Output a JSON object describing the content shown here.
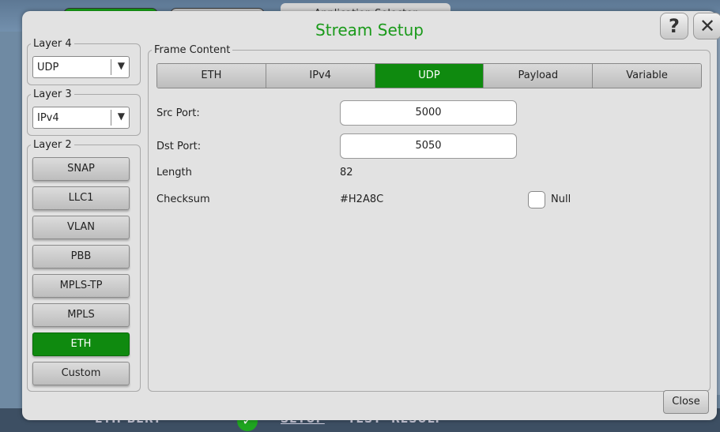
{
  "background": {
    "app_selector_label": "Application Selector",
    "bottom_bar": [
      "ETH-BERT",
      "SETUP",
      "TEST",
      "RESULT"
    ]
  },
  "dialog": {
    "title": "Stream Setup",
    "help_icon": "?",
    "close_icon": "✕",
    "close_button": "Close"
  },
  "layer4": {
    "legend": "Layer 4",
    "value": "UDP"
  },
  "layer3": {
    "legend": "Layer 3",
    "value": "IPv4"
  },
  "layer2": {
    "legend": "Layer 2",
    "buttons": [
      "SNAP",
      "LLC1",
      "VLAN",
      "PBB",
      "MPLS-TP",
      "MPLS",
      "ETH",
      "Custom"
    ],
    "active": "ETH"
  },
  "frame_content": {
    "legend": "Frame Content",
    "tabs": [
      "ETH",
      "IPv4",
      "UDP",
      "Payload",
      "Variable"
    ],
    "active_tab": "UDP",
    "fields": {
      "src_port_label": "Src Port:",
      "src_port_value": "5000",
      "dst_port_label": "Dst Port:",
      "dst_port_value": "5050",
      "length_label": "Length",
      "length_value": "82",
      "checksum_label": "Checksum",
      "checksum_value": "#H2A8C",
      "null_label": "Null",
      "null_checked": false
    }
  },
  "colors": {
    "accent_green": "#0f8a0f",
    "title_green": "#1a9a1a",
    "dialog_bg": "#e2e2e2"
  }
}
